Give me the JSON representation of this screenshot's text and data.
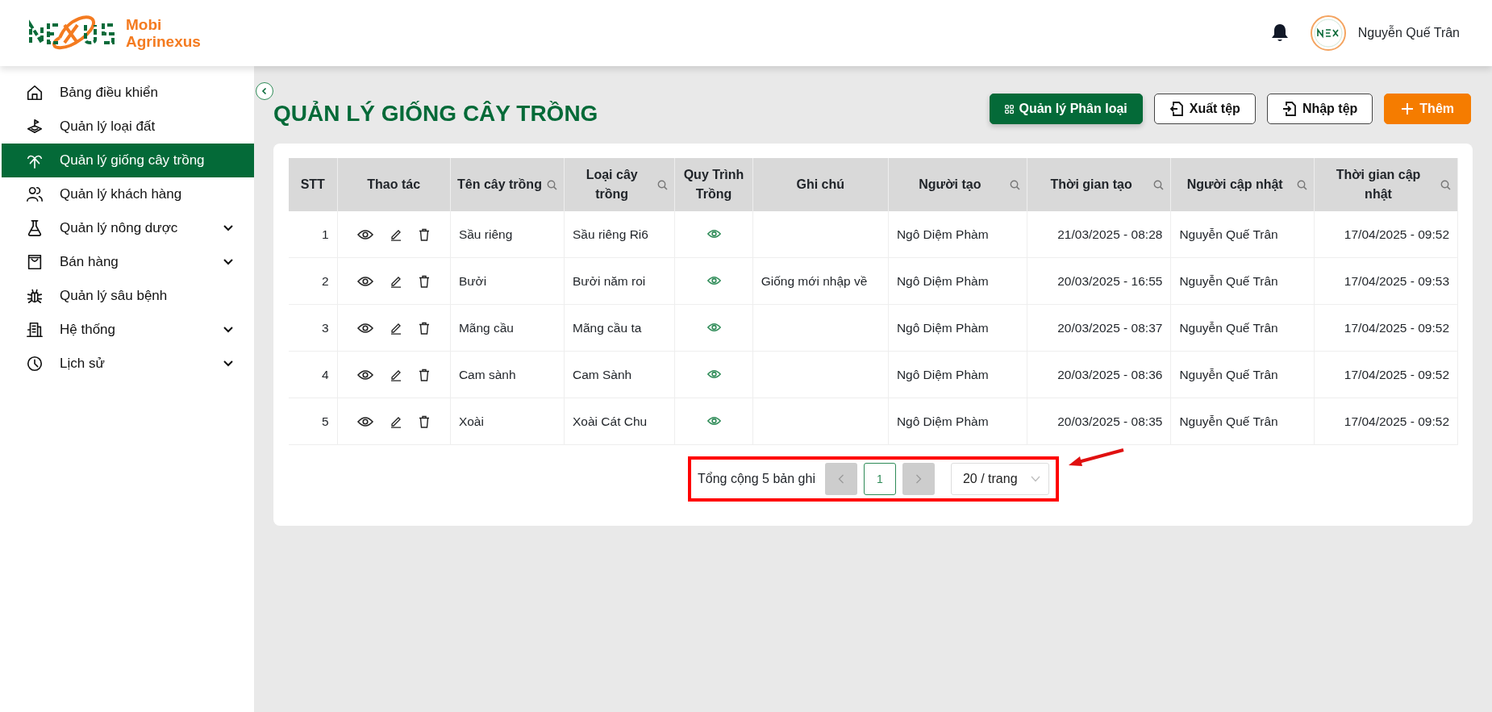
{
  "brand": {
    "line_1": "Mobi",
    "line_2": "Agrinexus"
  },
  "header": {
    "user_name": "Nguyễn Quế Trân"
  },
  "sidebar": {
    "items": [
      {
        "label": "Bảng điều khiển",
        "selected": false,
        "has_submenu": false
      },
      {
        "label": "Quản lý loại đất",
        "selected": false,
        "has_submenu": false
      },
      {
        "label": "Quản lý giống cây trồng",
        "selected": true,
        "has_submenu": false
      },
      {
        "label": "Quản lý khách hàng",
        "selected": false,
        "has_submenu": false
      },
      {
        "label": "Quản lý nông dược",
        "selected": false,
        "has_submenu": true
      },
      {
        "label": "Bán hàng",
        "selected": false,
        "has_submenu": true
      },
      {
        "label": "Quản lý sâu bệnh",
        "selected": false,
        "has_submenu": false
      },
      {
        "label": "Hệ thống",
        "selected": false,
        "has_submenu": true
      },
      {
        "label": "Lịch sử",
        "selected": false,
        "has_submenu": true
      }
    ]
  },
  "page": {
    "title": "QUẢN LÝ GIỐNG CÂY TRỒNG",
    "buttons": [
      {
        "label": "Quản lý Phân loại",
        "kind": "primary"
      },
      {
        "label": "Xuất tệp",
        "kind": "export"
      },
      {
        "label": "Nhập tệp",
        "kind": "import"
      },
      {
        "label": "Thêm",
        "kind": "add"
      }
    ]
  },
  "table": {
    "columns": [
      {
        "label": "STT",
        "searchable": false
      },
      {
        "label": "Thao tác",
        "searchable": false
      },
      {
        "label": "Tên cây trồng",
        "searchable": true
      },
      {
        "label": "Loại cây trồng",
        "searchable": true
      },
      {
        "label": "Quy Trình Trồng",
        "searchable": false
      },
      {
        "label": "Ghi chú",
        "searchable": false
      },
      {
        "label": "Người tạo",
        "searchable": true
      },
      {
        "label": "Thời gian tạo",
        "searchable": true
      },
      {
        "label": "Người cập nhật",
        "searchable": true
      },
      {
        "label": "Thời gian cập nhật",
        "searchable": true
      }
    ],
    "rows": [
      {
        "stt": "1",
        "name": "Sầu riêng",
        "type": "Sầu riêng Ri6",
        "note": "",
        "creator": "Ngô Diệm Phàm",
        "created": "21/03/2025 - 08:28",
        "updater": "Nguyễn Quế Trân",
        "updated": "17/04/2025 - 09:52"
      },
      {
        "stt": "2",
        "name": "Bưởi",
        "type": "Bưởi năm roi",
        "note": "Giống mới nhập về",
        "creator": "Ngô Diệm Phàm",
        "created": "20/03/2025 - 16:55",
        "updater": "Nguyễn Quế Trân",
        "updated": "17/04/2025 - 09:53"
      },
      {
        "stt": "3",
        "name": "Mãng cầu",
        "type": "Mãng cầu ta",
        "note": "",
        "creator": "Ngô Diệm Phàm",
        "created": "20/03/2025 - 08:37",
        "updater": "Nguyễn Quế Trân",
        "updated": "17/04/2025 - 09:52"
      },
      {
        "stt": "4",
        "name": "Cam sành",
        "type": "Cam Sành",
        "note": "",
        "creator": "Ngô Diệm Phàm",
        "created": "20/03/2025 - 08:36",
        "updater": "Nguyễn Quế Trân",
        "updated": "17/04/2025 - 09:52"
      },
      {
        "stt": "5",
        "name": "Xoài",
        "type": "Xoài Cát Chu",
        "note": "",
        "creator": "Ngô Diệm Phàm",
        "created": "20/03/2025 - 08:35",
        "updater": "Nguyễn Quế Trân",
        "updated": "17/04/2025 - 09:52"
      }
    ]
  },
  "pagination": {
    "total": "Tổng cộng 5 bản ghi",
    "prev_disabled": true,
    "pages": [
      {
        "label": "1",
        "selected": true
      }
    ],
    "next_disabled": true,
    "page_size": "20 / trang"
  }
}
